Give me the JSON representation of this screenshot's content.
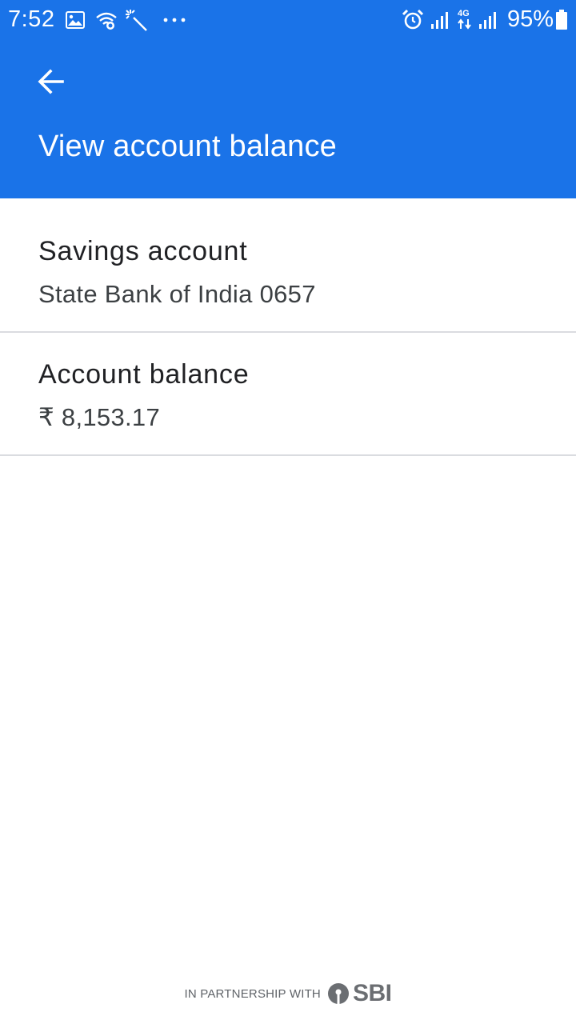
{
  "status_bar": {
    "time": "7:52",
    "network_type": "4G",
    "battery_percent": "95%",
    "icons": [
      "image-icon",
      "wifi-icon",
      "magic-wand-icon",
      "more-dots-icon",
      "alarm-icon",
      "signal-icon",
      "signal-icon",
      "battery-icon"
    ]
  },
  "app_bar": {
    "title": "View account balance",
    "background_color": "#1a73e8"
  },
  "account": {
    "type_label": "Savings account",
    "bank_detail": "State Bank of India 0657"
  },
  "balance": {
    "label": "Account balance",
    "value": "₹ 8,153.17"
  },
  "footer": {
    "partnership_text": "IN PARTNERSHIP WITH",
    "partner_logo_text": "SBI"
  }
}
